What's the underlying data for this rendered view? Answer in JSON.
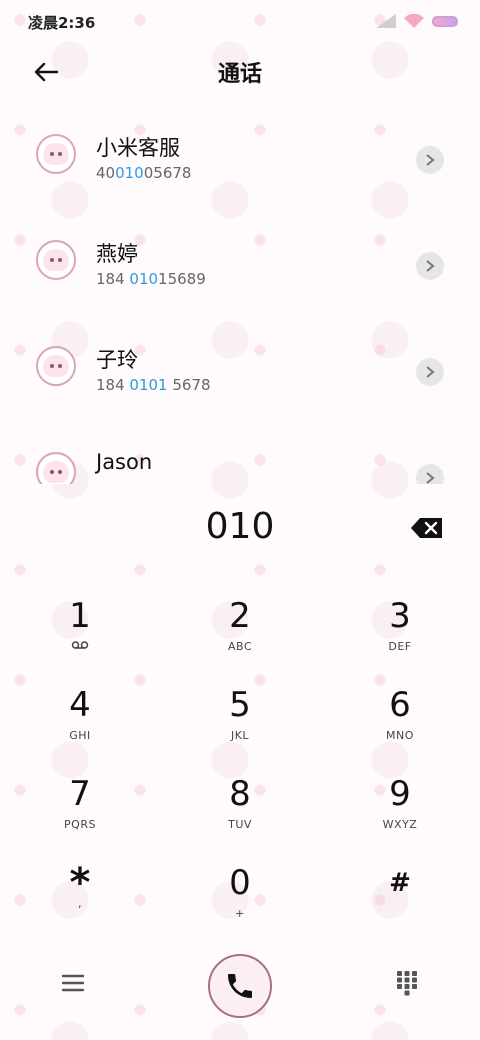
{
  "status_bar": {
    "time": "凌晨2:36"
  },
  "header": {
    "title": "通话"
  },
  "contacts": [
    {
      "name": "小米客服",
      "num_pre": "40",
      "num_match": "010",
      "num_post": "05678"
    },
    {
      "name": "燕婷",
      "num_pre": "184 ",
      "num_match": "010",
      "num_post": "15689"
    },
    {
      "name": "子玲",
      "num_pre": "184 ",
      "num_match": "0101",
      "num_post": " 5678"
    },
    {
      "name": "Jason",
      "num_pre": "",
      "num_match": "",
      "num_post": ""
    }
  ],
  "dialer": {
    "input_value": "010",
    "keys": [
      {
        "digit": "1",
        "letters": ""
      },
      {
        "digit": "2",
        "letters": "ABC"
      },
      {
        "digit": "3",
        "letters": "DEF"
      },
      {
        "digit": "4",
        "letters": "GHI"
      },
      {
        "digit": "5",
        "letters": "JKL"
      },
      {
        "digit": "6",
        "letters": "MNO"
      },
      {
        "digit": "7",
        "letters": "PQRS"
      },
      {
        "digit": "8",
        "letters": "TUV"
      },
      {
        "digit": "9",
        "letters": "WXYZ"
      },
      {
        "digit": "*",
        "letters": ","
      },
      {
        "digit": "0",
        "letters": "+"
      },
      {
        "digit": "#",
        "letters": ""
      }
    ]
  },
  "colors": {
    "match_highlight": "#2d9be0",
    "call_button_border": "#a8707e"
  },
  "icons": {
    "back": "arrow-left-icon",
    "chevron": "chevron-right-icon",
    "backspace": "backspace-icon",
    "voicemail": "voicemail-icon",
    "menu": "menu-icon",
    "call": "phone-icon",
    "keypad": "dialpad-icon"
  }
}
